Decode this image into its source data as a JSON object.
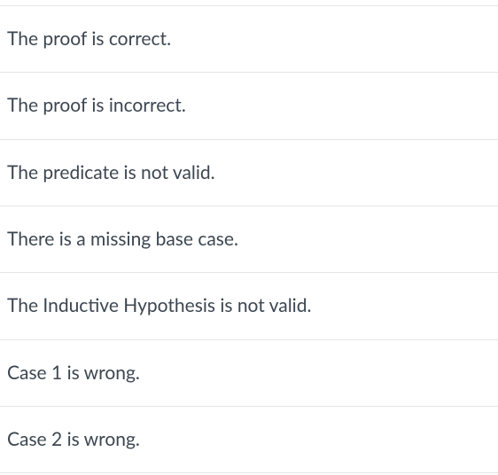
{
  "options": [
    {
      "label": "The proof is correct."
    },
    {
      "label": "The proof is incorrect."
    },
    {
      "label": "The predicate is not valid."
    },
    {
      "label": "There is a missing base case."
    },
    {
      "label": "The Inductive Hypothesis is not valid."
    },
    {
      "label": "Case 1 is wrong."
    },
    {
      "label": "Case 2 is wrong."
    }
  ]
}
